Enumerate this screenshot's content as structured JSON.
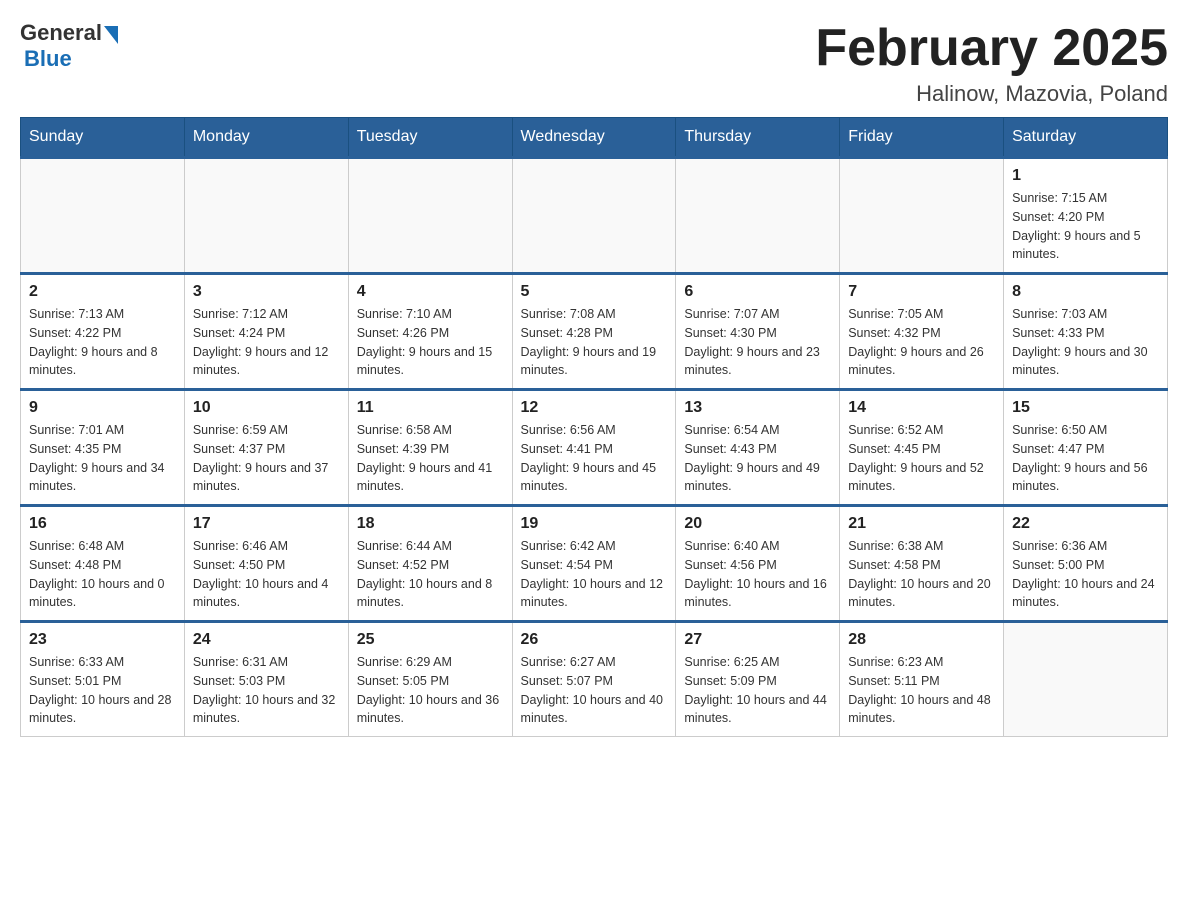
{
  "header": {
    "logo_general": "General",
    "logo_blue": "Blue",
    "month_title": "February 2025",
    "location": "Halinow, Mazovia, Poland"
  },
  "weekdays": [
    "Sunday",
    "Monday",
    "Tuesday",
    "Wednesday",
    "Thursday",
    "Friday",
    "Saturday"
  ],
  "weeks": [
    [
      {
        "day": "",
        "info": ""
      },
      {
        "day": "",
        "info": ""
      },
      {
        "day": "",
        "info": ""
      },
      {
        "day": "",
        "info": ""
      },
      {
        "day": "",
        "info": ""
      },
      {
        "day": "",
        "info": ""
      },
      {
        "day": "1",
        "info": "Sunrise: 7:15 AM\nSunset: 4:20 PM\nDaylight: 9 hours and 5 minutes."
      }
    ],
    [
      {
        "day": "2",
        "info": "Sunrise: 7:13 AM\nSunset: 4:22 PM\nDaylight: 9 hours and 8 minutes."
      },
      {
        "day": "3",
        "info": "Sunrise: 7:12 AM\nSunset: 4:24 PM\nDaylight: 9 hours and 12 minutes."
      },
      {
        "day": "4",
        "info": "Sunrise: 7:10 AM\nSunset: 4:26 PM\nDaylight: 9 hours and 15 minutes."
      },
      {
        "day": "5",
        "info": "Sunrise: 7:08 AM\nSunset: 4:28 PM\nDaylight: 9 hours and 19 minutes."
      },
      {
        "day": "6",
        "info": "Sunrise: 7:07 AM\nSunset: 4:30 PM\nDaylight: 9 hours and 23 minutes."
      },
      {
        "day": "7",
        "info": "Sunrise: 7:05 AM\nSunset: 4:32 PM\nDaylight: 9 hours and 26 minutes."
      },
      {
        "day": "8",
        "info": "Sunrise: 7:03 AM\nSunset: 4:33 PM\nDaylight: 9 hours and 30 minutes."
      }
    ],
    [
      {
        "day": "9",
        "info": "Sunrise: 7:01 AM\nSunset: 4:35 PM\nDaylight: 9 hours and 34 minutes."
      },
      {
        "day": "10",
        "info": "Sunrise: 6:59 AM\nSunset: 4:37 PM\nDaylight: 9 hours and 37 minutes."
      },
      {
        "day": "11",
        "info": "Sunrise: 6:58 AM\nSunset: 4:39 PM\nDaylight: 9 hours and 41 minutes."
      },
      {
        "day": "12",
        "info": "Sunrise: 6:56 AM\nSunset: 4:41 PM\nDaylight: 9 hours and 45 minutes."
      },
      {
        "day": "13",
        "info": "Sunrise: 6:54 AM\nSunset: 4:43 PM\nDaylight: 9 hours and 49 minutes."
      },
      {
        "day": "14",
        "info": "Sunrise: 6:52 AM\nSunset: 4:45 PM\nDaylight: 9 hours and 52 minutes."
      },
      {
        "day": "15",
        "info": "Sunrise: 6:50 AM\nSunset: 4:47 PM\nDaylight: 9 hours and 56 minutes."
      }
    ],
    [
      {
        "day": "16",
        "info": "Sunrise: 6:48 AM\nSunset: 4:48 PM\nDaylight: 10 hours and 0 minutes."
      },
      {
        "day": "17",
        "info": "Sunrise: 6:46 AM\nSunset: 4:50 PM\nDaylight: 10 hours and 4 minutes."
      },
      {
        "day": "18",
        "info": "Sunrise: 6:44 AM\nSunset: 4:52 PM\nDaylight: 10 hours and 8 minutes."
      },
      {
        "day": "19",
        "info": "Sunrise: 6:42 AM\nSunset: 4:54 PM\nDaylight: 10 hours and 12 minutes."
      },
      {
        "day": "20",
        "info": "Sunrise: 6:40 AM\nSunset: 4:56 PM\nDaylight: 10 hours and 16 minutes."
      },
      {
        "day": "21",
        "info": "Sunrise: 6:38 AM\nSunset: 4:58 PM\nDaylight: 10 hours and 20 minutes."
      },
      {
        "day": "22",
        "info": "Sunrise: 6:36 AM\nSunset: 5:00 PM\nDaylight: 10 hours and 24 minutes."
      }
    ],
    [
      {
        "day": "23",
        "info": "Sunrise: 6:33 AM\nSunset: 5:01 PM\nDaylight: 10 hours and 28 minutes."
      },
      {
        "day": "24",
        "info": "Sunrise: 6:31 AM\nSunset: 5:03 PM\nDaylight: 10 hours and 32 minutes."
      },
      {
        "day": "25",
        "info": "Sunrise: 6:29 AM\nSunset: 5:05 PM\nDaylight: 10 hours and 36 minutes."
      },
      {
        "day": "26",
        "info": "Sunrise: 6:27 AM\nSunset: 5:07 PM\nDaylight: 10 hours and 40 minutes."
      },
      {
        "day": "27",
        "info": "Sunrise: 6:25 AM\nSunset: 5:09 PM\nDaylight: 10 hours and 44 minutes."
      },
      {
        "day": "28",
        "info": "Sunrise: 6:23 AM\nSunset: 5:11 PM\nDaylight: 10 hours and 48 minutes."
      },
      {
        "day": "",
        "info": ""
      }
    ]
  ]
}
